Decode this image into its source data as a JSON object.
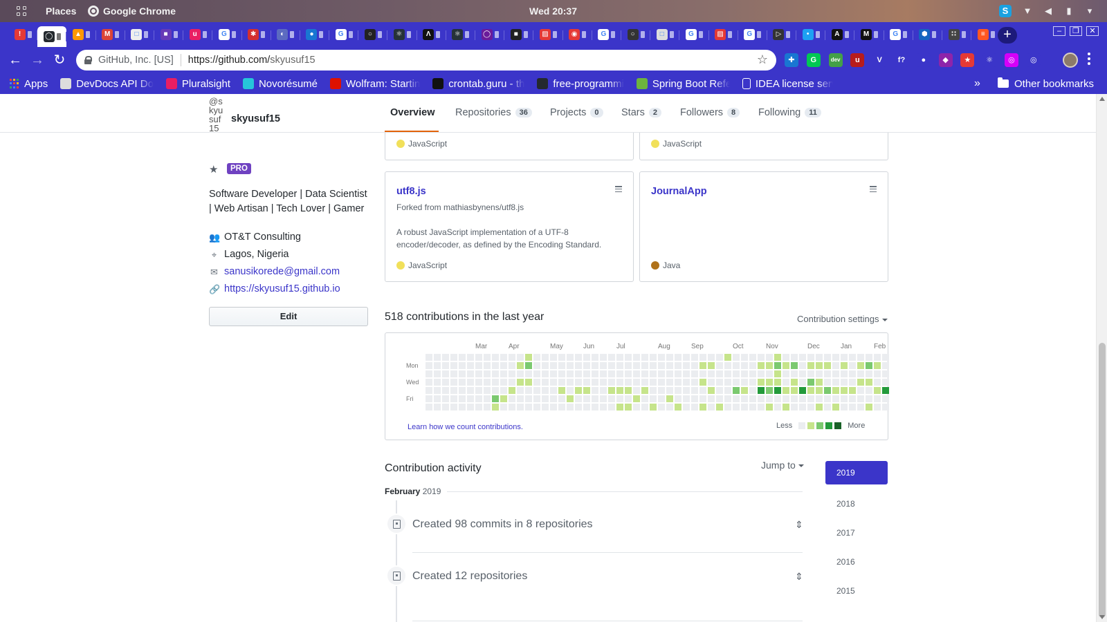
{
  "os_bar": {
    "places": "Places",
    "app": "Google Chrome",
    "clock": "Wed 20:37"
  },
  "browser": {
    "site_identity": "GitHub, Inc. [US]",
    "url_host": "https://github.com/",
    "url_path": "skyusuf15",
    "accent": "#3b35c9",
    "tab_favicons": [
      {
        "bg": "#e53935",
        "char": "!"
      },
      {
        "bg": "#24292e",
        "char": "◯"
      },
      {
        "bg": "#ff9800",
        "char": "▲"
      },
      {
        "bg": "#db4437",
        "char": "M"
      },
      {
        "bg": "#eeeeee",
        "char": "□"
      },
      {
        "bg": "#673ab7",
        "char": "■"
      },
      {
        "bg": "#e91e63",
        "char": "u"
      },
      {
        "bg": "#ffffff",
        "char": "G"
      },
      {
        "bg": "#d32f2f",
        "char": "✱"
      },
      {
        "bg": "#5c6bc0",
        "char": "◐"
      },
      {
        "bg": "#1976d2",
        "char": "●"
      },
      {
        "bg": "#ffffff",
        "char": "G"
      },
      {
        "bg": "#222222",
        "char": "○"
      },
      {
        "bg": "#263238",
        "char": "⚛"
      },
      {
        "bg": "#111111",
        "char": "Λ"
      },
      {
        "bg": "#263238",
        "char": "⚛"
      },
      {
        "bg": "#6a1b9a",
        "char": "◯"
      },
      {
        "bg": "#212121",
        "char": "■"
      },
      {
        "bg": "#e53935",
        "char": "▨"
      },
      {
        "bg": "#e53935",
        "char": "◉"
      },
      {
        "bg": "#ffffff",
        "char": "G"
      },
      {
        "bg": "#333333",
        "char": "○"
      },
      {
        "bg": "#dddddd",
        "char": "□"
      },
      {
        "bg": "#ffffff",
        "char": "G"
      },
      {
        "bg": "#e53935",
        "char": "▨"
      },
      {
        "bg": "#ffffff",
        "char": "G"
      },
      {
        "bg": "#333333",
        "char": "▷"
      },
      {
        "bg": "#1da1f2",
        "char": "•"
      },
      {
        "bg": "#111111",
        "char": "A"
      },
      {
        "bg": "#111111",
        "char": "M"
      },
      {
        "bg": "#ffffff",
        "char": "G"
      },
      {
        "bg": "#1565c0",
        "char": "⬢"
      },
      {
        "bg": "#444444",
        "char": "∷"
      },
      {
        "bg": "#ff5722",
        "char": "≡"
      }
    ],
    "extensions": [
      {
        "bg": "#1976d2",
        "char": "✚"
      },
      {
        "bg": "#00c853",
        "char": "G"
      },
      {
        "bg": "#43a047",
        "char": "dev"
      },
      {
        "bg": "#b71c1c",
        "char": "u"
      },
      {
        "bg": "#3b35c9",
        "char": "V"
      },
      {
        "bg": "#3b35c9",
        "char": "f?"
      },
      {
        "bg": "#3b35c9",
        "char": "●"
      },
      {
        "bg": "#8e24aa",
        "char": "◆"
      },
      {
        "bg": "#e53935",
        "char": "★"
      },
      {
        "bg": "#3b35c9",
        "char": "⚛"
      },
      {
        "bg": "#d500f9",
        "char": "◎"
      },
      {
        "bg": "#3b35c9",
        "char": "◎"
      }
    ]
  },
  "bookmarks": {
    "items": [
      {
        "label": "Apps",
        "icon": "apps-icon",
        "color": "#4caf50"
      },
      {
        "label": "DevDocs API Do",
        "icon": "devdocs-icon",
        "color": "#dddddd"
      },
      {
        "label": "Pluralsight",
        "icon": "pluralsight-icon",
        "color": "#e91e63"
      },
      {
        "label": "Novorésumé",
        "icon": "novoresume-icon",
        "color": "#26c6da"
      },
      {
        "label": "Wolfram: Startin",
        "icon": "wolfram-icon",
        "color": "#dd1100"
      },
      {
        "label": "crontab.guru - th",
        "icon": "crontab-icon",
        "color": "#111111"
      },
      {
        "label": "free-programmi",
        "icon": "github-icon",
        "color": "#24292e"
      },
      {
        "label": "Spring Boot Refe",
        "icon": "spring-icon",
        "color": "#6db33f"
      },
      {
        "label": "IDEA license serv",
        "icon": "page-icon",
        "color": "#ffffff"
      }
    ],
    "overflow": "»",
    "other": "Other bookmarks"
  },
  "profile": {
    "avatar_alt": "@skyusuf15",
    "username": "skyusuf15",
    "pro_badge": "PRO",
    "bio": "Software Developer | Data Scientist | Web Artisan | Tech Lover | Gamer",
    "company": "OT&T Consulting",
    "location": "Lagos, Nigeria",
    "email": "sanusikorede@gmail.com",
    "website": "https://skyusuf15.github.io",
    "edit_label": "Edit"
  },
  "nav": {
    "overview": "Overview",
    "repositories": "Repositories",
    "repositories_count": "36",
    "projects": "Projects",
    "projects_count": "0",
    "stars": "Stars",
    "stars_count": "2",
    "followers": "Followers",
    "followers_count": "8",
    "following": "Following",
    "following_count": "11"
  },
  "pinned": {
    "top_left_lang": "JavaScript",
    "top_right_lang": "JavaScript",
    "utf8": {
      "title": "utf8.js",
      "forked": "Forked from mathiasbynens/utf8.js",
      "desc": "A robust JavaScript implementation of a UTF-8 encoder/decoder, as defined by the Encoding Standard.",
      "lang": "JavaScript",
      "lang_color": "#f1e05a"
    },
    "journal": {
      "title": "JournalApp",
      "lang": "Java",
      "lang_color": "#b07219"
    }
  },
  "contributions": {
    "title": "518 contributions in the last year",
    "settings": "Contribution settings",
    "months": [
      "Mar",
      "Apr",
      "May",
      "Jun",
      "Jul",
      "Aug",
      "Sep",
      "Oct",
      "Nov",
      "Dec",
      "Jan",
      "Feb"
    ],
    "days": [
      "Mon",
      "Wed",
      "Fri"
    ],
    "learn_link": "Learn how we count contributions.",
    "less": "Less",
    "more": "More",
    "palette": [
      "#ebedf0",
      "#c6e48b",
      "#7bc96f",
      "#239a3b",
      "#196127"
    ],
    "weeks": [
      "0000000",
      "0000000",
      "0000000",
      "0000000",
      "0000000",
      "0000000",
      "0000000",
      "0000000",
      "0000021",
      "0000010",
      "0000100",
      "0101000",
      "1201000",
      "0000000",
      "0000000",
      "0000000",
      "0000100",
      "0000010",
      "0000100",
      "0000100",
      "0000000",
      "0000000",
      "0000100",
      "0000101",
      "0000101",
      "0000010",
      "0000100",
      "0000001",
      "0000000",
      "0000010",
      "0000001",
      "0000000",
      "0000000",
      "0101001",
      "0100100",
      "0000001",
      "1000000",
      "0000200",
      "0000100",
      "0000000",
      "0101300",
      "0101201",
      "1211300",
      "0100101",
      "0201100",
      "0000300",
      "0102100",
      "0101101",
      "0100200",
      "0000101",
      "0100100",
      "0000100",
      "0101000",
      "0201001",
      "0100100",
      "0000300",
      "0000011",
      "0101220",
      "0000101",
      "0001000",
      "0100100",
      "0220011",
      "0010100",
      "1201100",
      "0102301",
      "0012202",
      "0000201",
      "0110110",
      "0000100",
      "0001000",
      "0002111",
      "0000300",
      "0110101",
      "0000000"
    ]
  },
  "activity": {
    "title": "Contribution activity",
    "jump_to": "Jump to",
    "month": "February",
    "year": "2019",
    "item1": "Created 98 commits in 8 repositories",
    "item2": "Created 12 repositories",
    "years": [
      "2019",
      "2018",
      "2017",
      "2016",
      "2015"
    ]
  }
}
